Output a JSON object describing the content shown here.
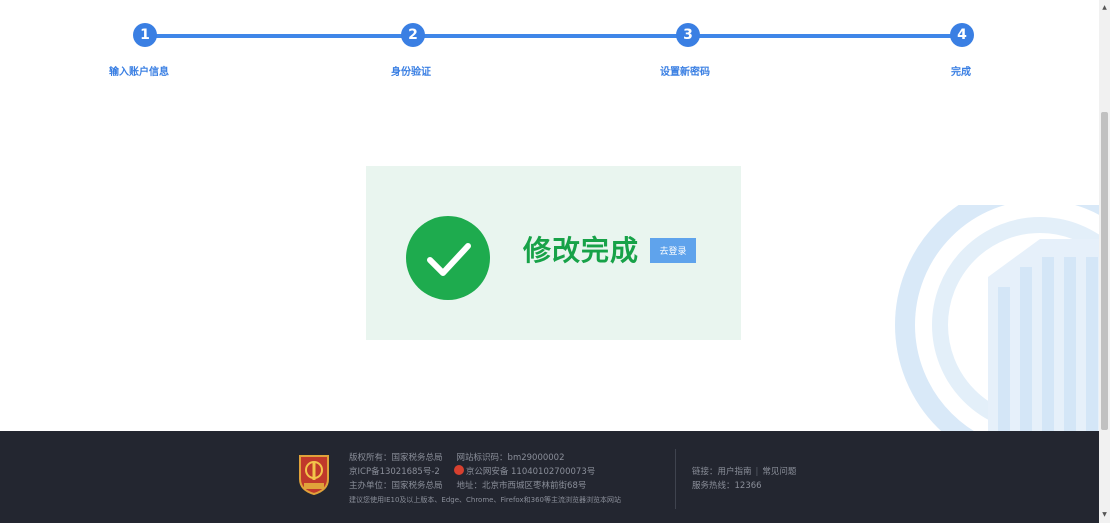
{
  "steps": [
    {
      "number": "1",
      "label": "输入账户信息"
    },
    {
      "number": "2",
      "label": "身份验证"
    },
    {
      "number": "3",
      "label": "设置新密码"
    },
    {
      "number": "4",
      "label": "完成"
    }
  ],
  "result": {
    "message": "修改完成",
    "login_button": "去登录"
  },
  "footer": {
    "copyright_label": "版权所有：",
    "copyright_value": "国家税务总局",
    "site_id_label": "网站标识码：",
    "site_id_value": "bm29000002",
    "icp": "京ICP备13021685号-2",
    "police_record": "京公网安备 11040102700073号",
    "sponsor_label": "主办单位：",
    "sponsor_value": "国家税务总局",
    "address_label": "地址：",
    "address_value": "北京市西城区枣林前街68号",
    "browser_note": "建议您使用IE10及以上版本、Edge、Chrome、Firefox和360等主流浏览器浏览本网站",
    "links_label": "链接：",
    "link_user_guide": "用户指南",
    "link_faq": "常见问题",
    "hotline_label": "服务热线：",
    "hotline_value": "12366"
  },
  "colors": {
    "step_blue": "#3a7fe3",
    "success_green": "#1eab4e",
    "success_bg": "#e9f5ef",
    "footer_bg": "#232630"
  },
  "icons": [
    "check-icon",
    "tax-emblem-icon",
    "police-badge-icon",
    "tax-watermark-icon"
  ]
}
